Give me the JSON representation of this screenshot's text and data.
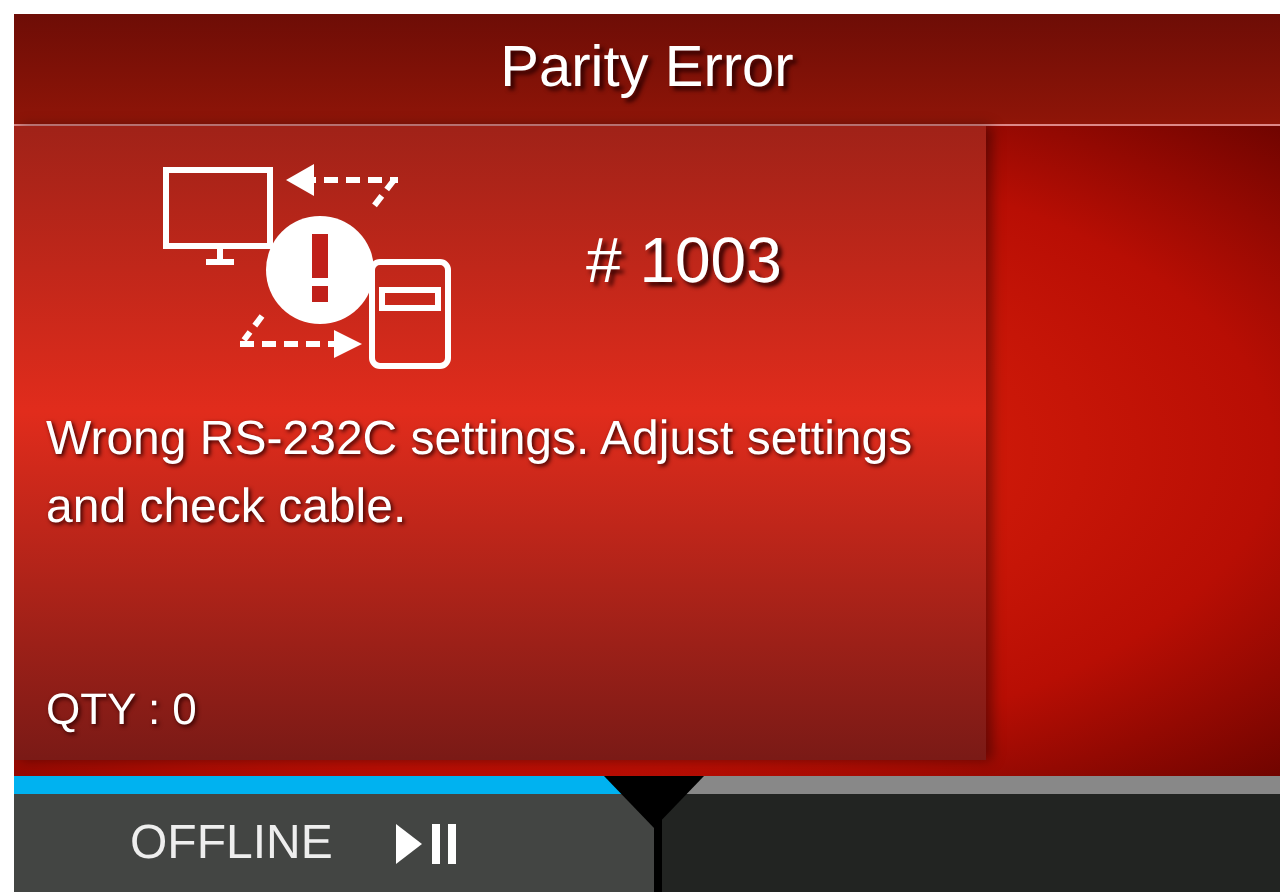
{
  "title": "Parity Error",
  "error": {
    "code": "# 1003",
    "message": "Wrong RS-232C settings. Adjust settings and check cable.",
    "quantity": "QTY : 0"
  },
  "offline_button": {
    "label": "OFFLINE",
    "selected": true
  }
}
